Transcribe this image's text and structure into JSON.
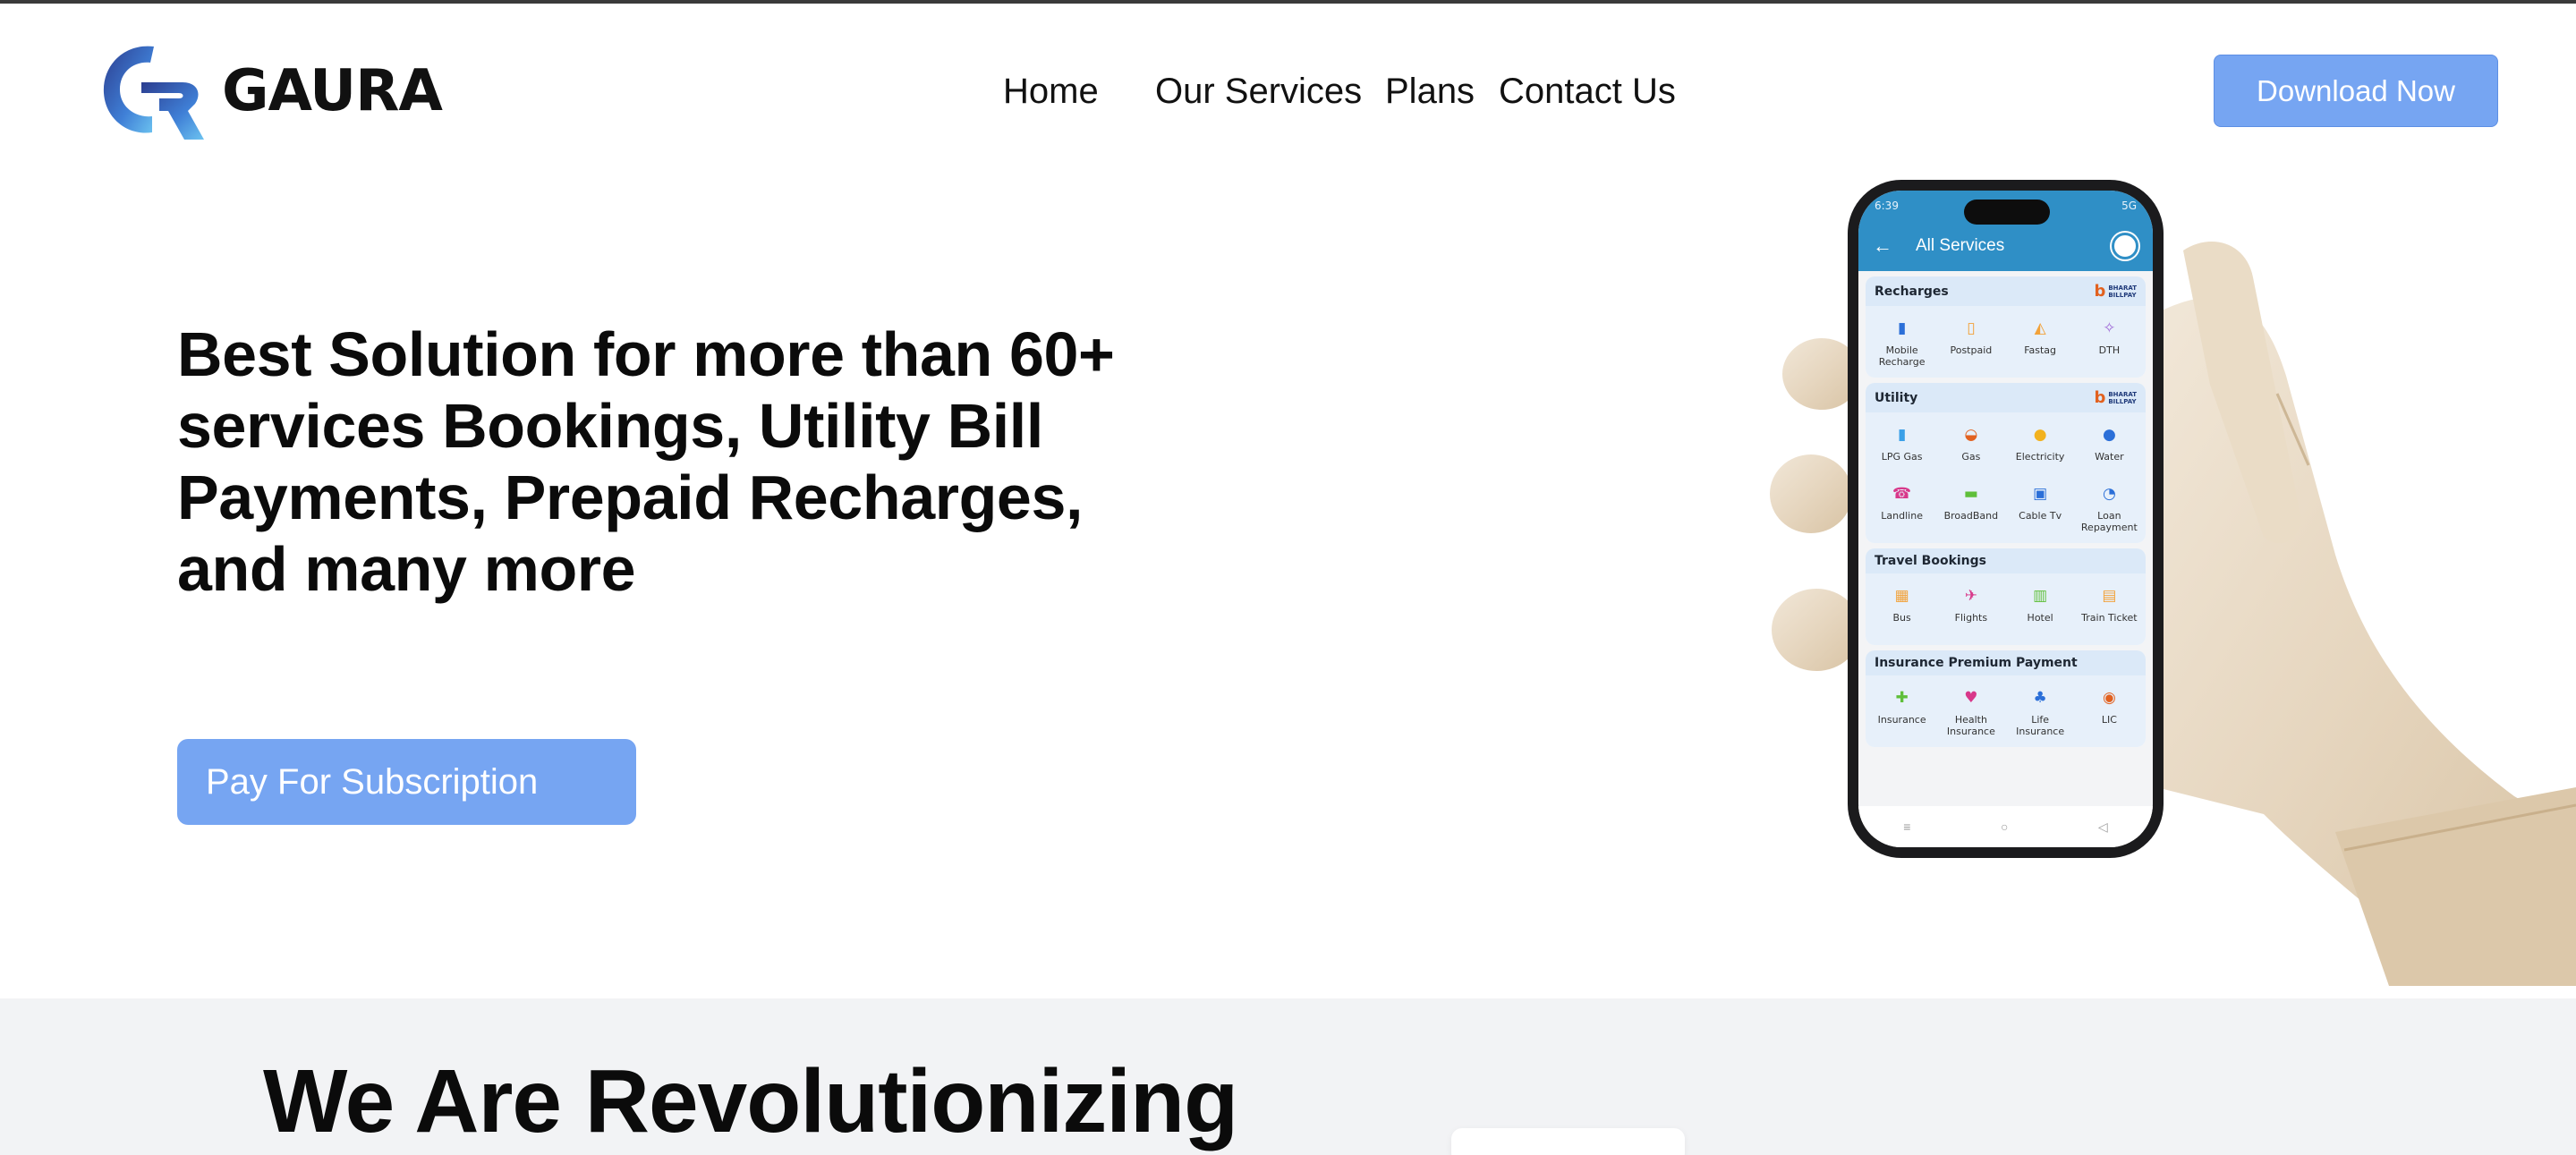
{
  "brand": {
    "name": "GAURA",
    "logo_icon": "gaura-g-mark",
    "accent": "#76a5f2"
  },
  "nav": {
    "items": [
      {
        "label": "Home"
      },
      {
        "label": "Our Services"
      },
      {
        "label": "Plans"
      },
      {
        "label": "Contact Us"
      }
    ],
    "cta_label": "Download Now"
  },
  "hero": {
    "title": "Best Solution for more than 60+ services Bookings, Utility Bill Payments, Prepaid Recharges, and many more",
    "cta_label": "Pay For Subscription"
  },
  "phone": {
    "status_time": "6:39",
    "status_right": "5G",
    "screen_title": "All Services",
    "sections": [
      {
        "title": "Recharges",
        "bharat": true,
        "items": [
          {
            "label": "Mobile Recharge",
            "icon": "mobile-icon",
            "color": "#2b6fd8"
          },
          {
            "label": "Postpaid",
            "icon": "postpaid-icon",
            "color": "#f2a23a"
          },
          {
            "label": "Fastag",
            "icon": "fastag-icon",
            "color": "#f2a23a"
          },
          {
            "label": "DTH",
            "icon": "dth-icon",
            "color": "#a16cd8"
          }
        ]
      },
      {
        "title": "Utility",
        "bharat": true,
        "items": [
          {
            "label": "LPG Gas",
            "icon": "lpg-icon",
            "color": "#3aa0e8"
          },
          {
            "label": "Gas",
            "icon": "gas-icon",
            "color": "#e2611f"
          },
          {
            "label": "Electricity",
            "icon": "electricity-icon",
            "color": "#f2b21f"
          },
          {
            "label": "Water",
            "icon": "water-icon",
            "color": "#2b6fd8"
          },
          {
            "label": "Landline",
            "icon": "landline-icon",
            "color": "#d8388a"
          },
          {
            "label": "BroadBand",
            "icon": "broadband-icon",
            "color": "#5fbf3a"
          },
          {
            "label": "Cable Tv",
            "icon": "cable-tv-icon",
            "color": "#2b6fd8"
          },
          {
            "label": "Loan Repayment",
            "icon": "loan-icon",
            "color": "#2b6fd8"
          }
        ]
      },
      {
        "title": "Travel Bookings",
        "bharat": false,
        "items": [
          {
            "label": "Bus",
            "icon": "bus-icon",
            "color": "#f2a23a"
          },
          {
            "label": "Flights",
            "icon": "flight-icon",
            "color": "#d8388a"
          },
          {
            "label": "Hotel",
            "icon": "hotel-icon",
            "color": "#5fbf3a"
          },
          {
            "label": "Train Ticket",
            "icon": "train-icon",
            "color": "#f2a23a"
          }
        ]
      },
      {
        "title": "Insurance Premium Payment",
        "bharat": false,
        "items": [
          {
            "label": "Insurance",
            "icon": "insurance-icon",
            "color": "#5fbf3a"
          },
          {
            "label": "Health Insurance",
            "icon": "health-insurance-icon",
            "color": "#d8388a"
          },
          {
            "label": "Life Insurance",
            "icon": "life-insurance-icon",
            "color": "#2b6fd8"
          },
          {
            "label": "LIC",
            "icon": "lic-icon",
            "color": "#e2611f"
          }
        ]
      }
    ]
  },
  "section2": {
    "title": "We Are Revolutionizing"
  }
}
